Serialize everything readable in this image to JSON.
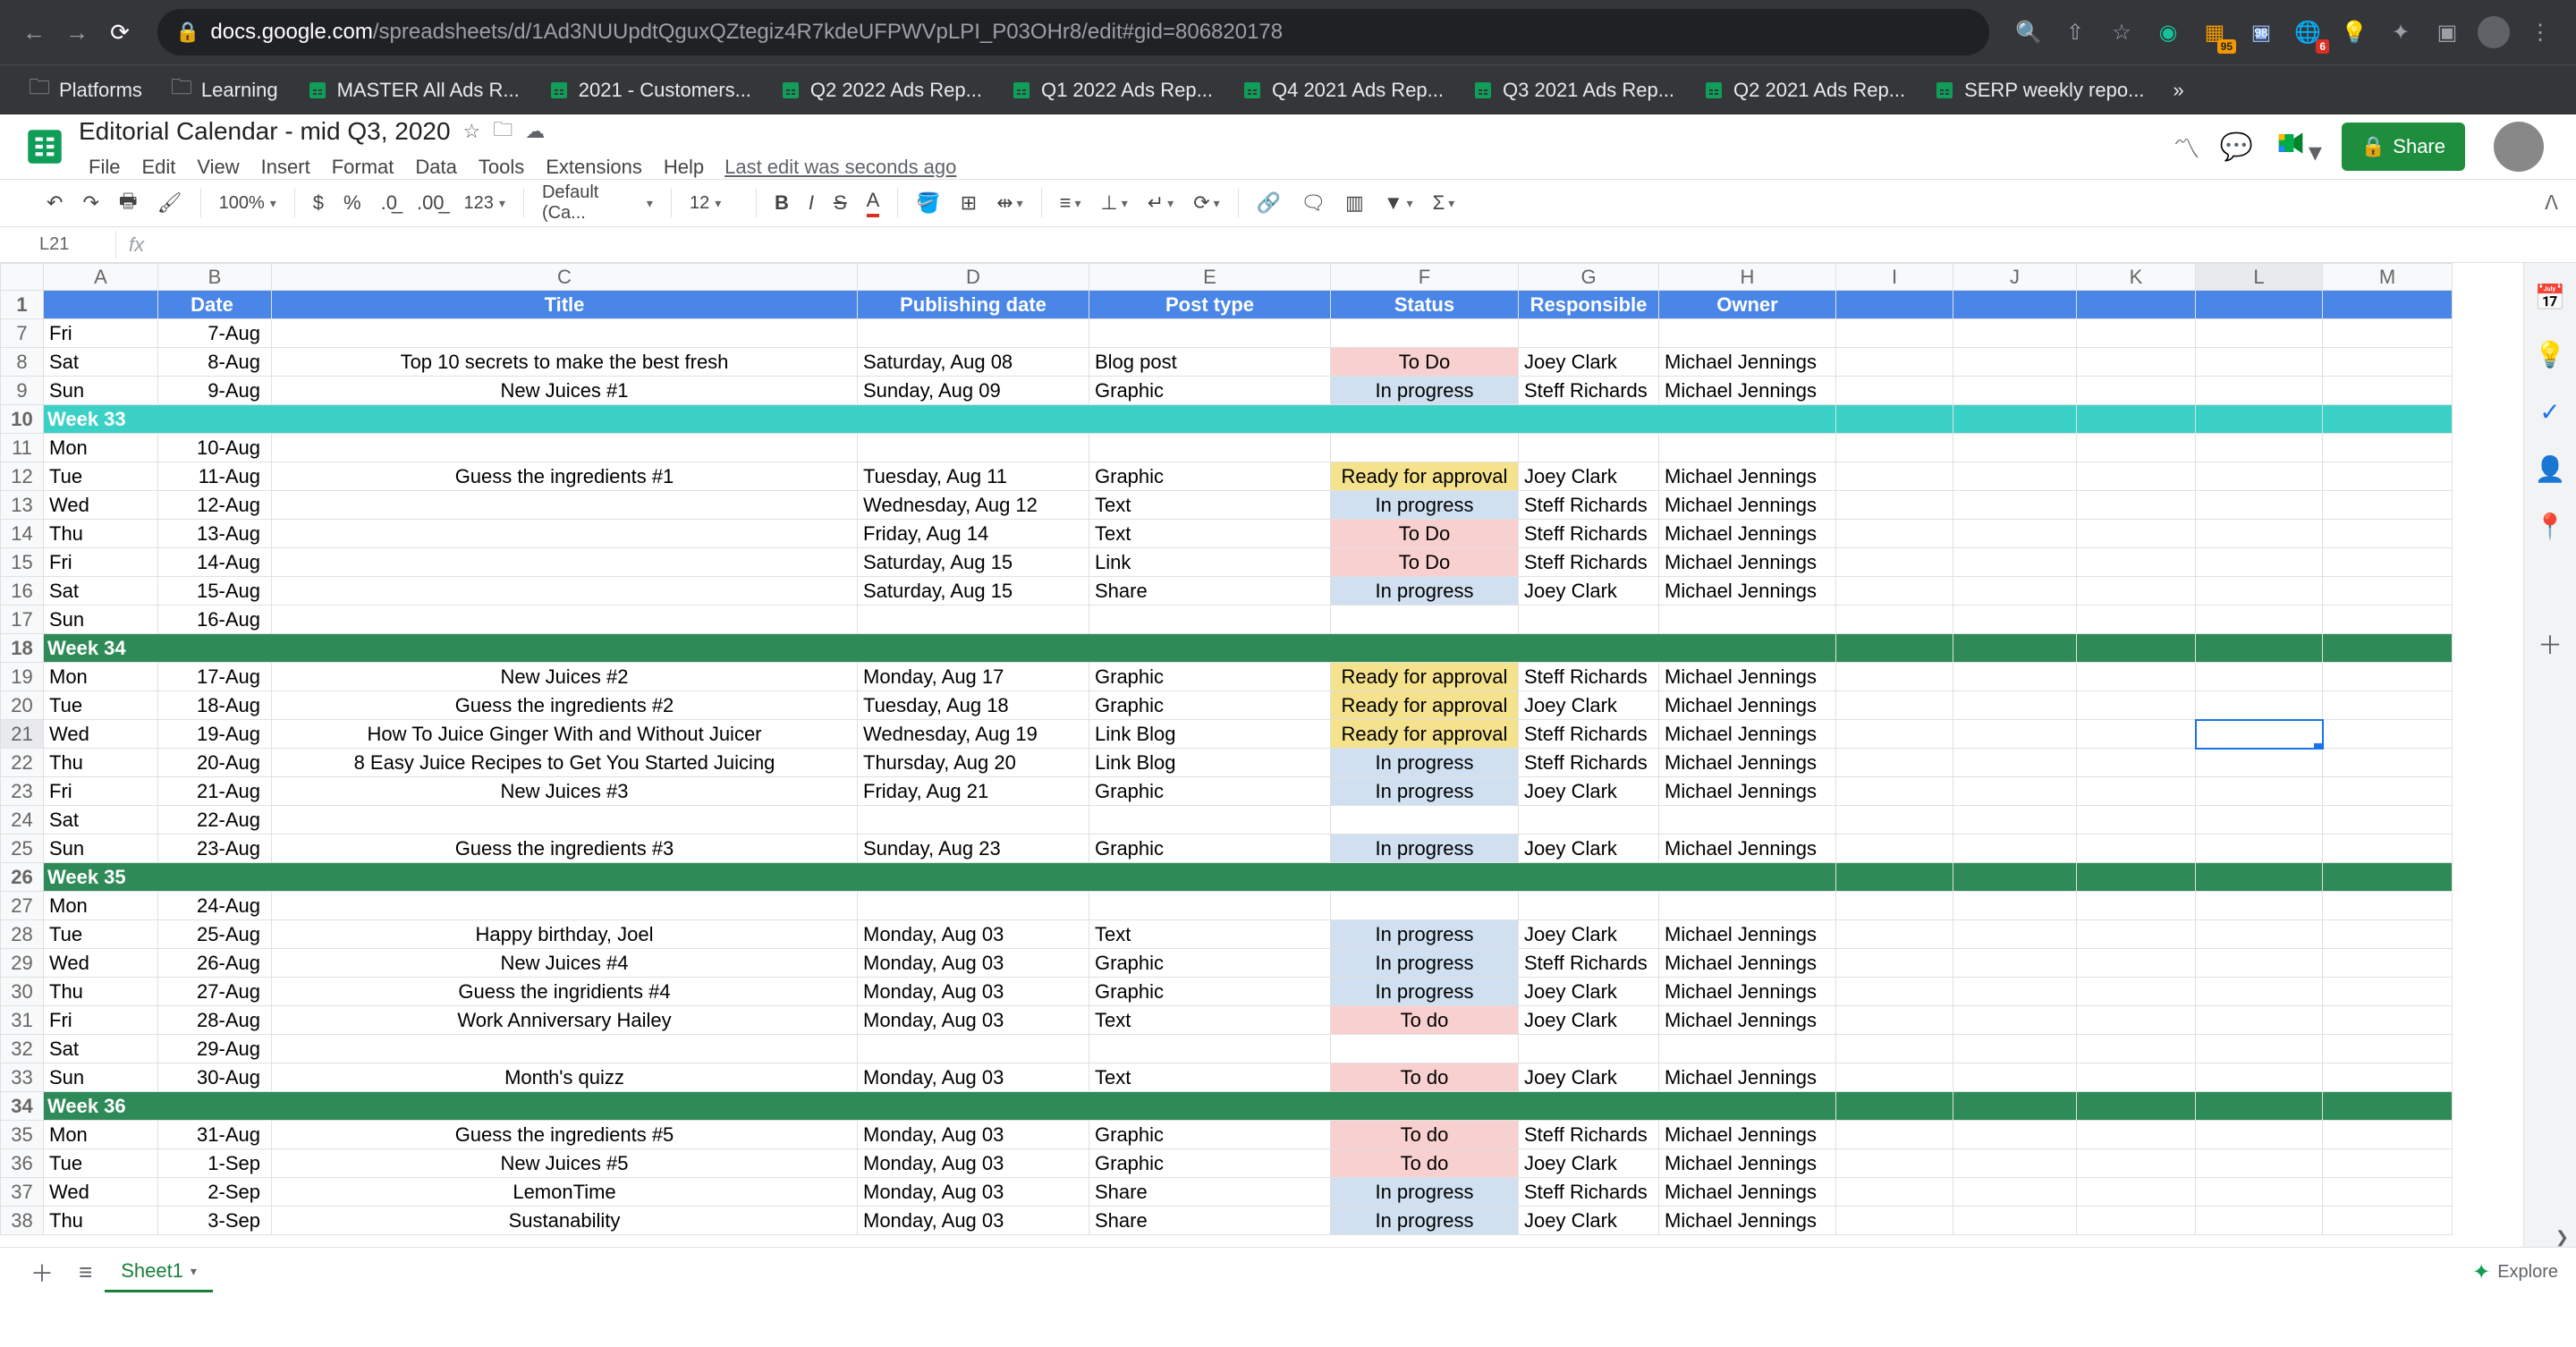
{
  "browser": {
    "url_domain": "docs.google.com",
    "url_path": "/spreadsheets/d/1Ad3NUUpdtQguxQZtegiz4R7kdeUFPWVpLPI_P03OHr8/edit#gid=806820178",
    "ext_badge_95": "95",
    "ext_badge_98": "98",
    "ext_badge_6": "6",
    "overflow": "»",
    "bookmarks": [
      {
        "type": "folder",
        "label": "Platforms"
      },
      {
        "type": "folder",
        "label": "Learning"
      },
      {
        "type": "sheet",
        "label": "MASTER All Ads R..."
      },
      {
        "type": "sheet",
        "label": "2021 - Customers..."
      },
      {
        "type": "sheet",
        "label": "Q2 2022 Ads Rep..."
      },
      {
        "type": "sheet",
        "label": "Q1 2022 Ads Rep..."
      },
      {
        "type": "sheet",
        "label": "Q4 2021 Ads Rep..."
      },
      {
        "type": "sheet",
        "label": "Q3 2021 Ads Rep..."
      },
      {
        "type": "sheet",
        "label": "Q2 2021 Ads Rep..."
      },
      {
        "type": "sheet",
        "label": "SERP weekly repo..."
      }
    ]
  },
  "doc": {
    "title": "Editorial Calendar - mid Q3, 2020",
    "menus": [
      "File",
      "Edit",
      "View",
      "Insert",
      "Format",
      "Data",
      "Tools",
      "Extensions",
      "Help"
    ],
    "last_edit": "Last edit was seconds ago",
    "share": "Share"
  },
  "toolbar": {
    "zoom": "100%",
    "font": "Default (Ca...",
    "size": "12",
    "more": "123"
  },
  "namebox": {
    "cell": "L21",
    "fx": "fx"
  },
  "sheet": {
    "tab": "Sheet1",
    "columns": [
      "A",
      "B",
      "C",
      "D",
      "E",
      "F",
      "G",
      "H",
      "I",
      "J",
      "K",
      "L",
      "M"
    ],
    "header": {
      "A": "",
      "B": "Date",
      "C": "Title",
      "D": "Publishing date",
      "E": "Post type",
      "F": "Status",
      "G": "Responsible",
      "H": "Owner"
    },
    "rows": [
      {
        "n": 7,
        "A": "Fri",
        "B": "7-Aug"
      },
      {
        "n": 8,
        "A": "Sat",
        "B": "8-Aug",
        "C": "Top 10 secrets to make the best fresh",
        "D": "Saturday, Aug 08",
        "E": "Blog post",
        "F": "To Do",
        "Fc": "st-todo",
        "G": "Joey Clark",
        "H": "Michael Jennings"
      },
      {
        "n": 9,
        "A": "Sun",
        "B": "9-Aug",
        "C": "New Juices #1",
        "D": "Sunday, Aug 09",
        "E": "Graphic",
        "F": "In progress",
        "Fc": "st-prog",
        "G": "Steff Richards",
        "H": "Michael Jennings"
      },
      {
        "n": 10,
        "week": "wk33",
        "A": "Week 33"
      },
      {
        "n": 11,
        "A": "Mon",
        "B": "10-Aug"
      },
      {
        "n": 12,
        "A": "Tue",
        "B": "11-Aug",
        "C": "Guess the ingredients #1",
        "D": "Tuesday, Aug 11",
        "E": "Graphic",
        "F": "Ready for approval",
        "Fc": "st-appr",
        "G": "Joey Clark",
        "H": "Michael Jennings"
      },
      {
        "n": 13,
        "A": "Wed",
        "B": "12-Aug",
        "D": "Wednesday, Aug 12",
        "E": "Text",
        "F": "In progress",
        "Fc": "st-prog",
        "G": "Steff Richards",
        "H": "Michael Jennings"
      },
      {
        "n": 14,
        "A": "Thu",
        "B": "13-Aug",
        "D": "Friday, Aug 14",
        "E": "Text",
        "F": "To Do",
        "Fc": "st-todo",
        "G": "Steff Richards",
        "H": "Michael Jennings"
      },
      {
        "n": 15,
        "A": "Fri",
        "B": "14-Aug",
        "D": "Saturday, Aug 15",
        "E": "Link",
        "F": "To Do",
        "Fc": "st-todo",
        "G": "Steff Richards",
        "H": "Michael Jennings"
      },
      {
        "n": 16,
        "A": "Sat",
        "B": "15-Aug",
        "D": "Saturday, Aug 15",
        "E": "Share",
        "F": "In progress",
        "Fc": "st-prog",
        "G": "Joey Clark",
        "H": "Michael Jennings"
      },
      {
        "n": 17,
        "A": "Sun",
        "B": "16-Aug"
      },
      {
        "n": 18,
        "week": "wk34",
        "A": "Week 34"
      },
      {
        "n": 19,
        "A": "Mon",
        "B": "17-Aug",
        "C": "New Juices #2",
        "D": "Monday, Aug 17",
        "E": "Graphic",
        "F": "Ready for approval",
        "Fc": "st-appr",
        "G": "Steff Richards",
        "H": "Michael Jennings"
      },
      {
        "n": 20,
        "A": "Tue",
        "B": "18-Aug",
        "C": "Guess the ingredients #2",
        "D": "Tuesday, Aug 18",
        "E": "Graphic",
        "F": "Ready for approval",
        "Fc": "st-appr",
        "G": "Joey Clark",
        "H": "Michael Jennings"
      },
      {
        "n": 21,
        "A": "Wed",
        "B": "19-Aug",
        "C": "How To Juice Ginger With and Without Juicer",
        "D": "Wednesday, Aug 19",
        "E": "Link Blog",
        "F": "Ready for approval",
        "Fc": "st-appr",
        "G": "Steff Richards",
        "H": "Michael Jennings"
      },
      {
        "n": 22,
        "A": "Thu",
        "B": "20-Aug",
        "C": "8 Easy Juice Recipes to Get You Started Juicing",
        "D": "Thursday, Aug 20",
        "E": "Link Blog",
        "F": "In progress",
        "Fc": "st-prog",
        "G": "Steff Richards",
        "H": "Michael Jennings"
      },
      {
        "n": 23,
        "A": "Fri",
        "B": "21-Aug",
        "C": "New Juices #3",
        "D": "Friday, Aug 21",
        "E": "Graphic",
        "F": "In progress",
        "Fc": "st-prog",
        "G": "Joey Clark",
        "H": "Michael Jennings"
      },
      {
        "n": 24,
        "A": "Sat",
        "B": "22-Aug"
      },
      {
        "n": 25,
        "A": "Sun",
        "B": "23-Aug",
        "C": "Guess the ingredients #3",
        "D": "Sunday, Aug 23",
        "E": "Graphic",
        "F": "In progress",
        "Fc": "st-prog",
        "G": "Joey Clark",
        "H": "Michael Jennings"
      },
      {
        "n": 26,
        "week": "wk34",
        "A": "Week 35"
      },
      {
        "n": 27,
        "A": "Mon",
        "B": "24-Aug"
      },
      {
        "n": 28,
        "A": "Tue",
        "B": "25-Aug",
        "C": "Happy birthday, Joel",
        "D": "Monday, Aug 03",
        "E": "Text",
        "F": "In progress",
        "Fc": "st-prog",
        "G": "Joey Clark",
        "H": "Michael Jennings"
      },
      {
        "n": 29,
        "A": "Wed",
        "B": "26-Aug",
        "C": "New Juices #4",
        "D": "Monday, Aug 03",
        "E": "Graphic",
        "F": "In progress",
        "Fc": "st-prog",
        "G": "Steff Richards",
        "H": "Michael Jennings"
      },
      {
        "n": 30,
        "A": "Thu",
        "B": "27-Aug",
        "C": "Guess the ingridients #4",
        "D": "Monday, Aug 03",
        "E": "Graphic",
        "F": "In progress",
        "Fc": "st-prog",
        "G": "Joey Clark",
        "H": "Michael Jennings"
      },
      {
        "n": 31,
        "A": "Fri",
        "B": "28-Aug",
        "C": "Work Anniversary Hailey",
        "D": "Monday, Aug 03",
        "E": "Text",
        "F": "To do",
        "Fc": "st-todo",
        "G": "Joey Clark",
        "H": "Michael Jennings"
      },
      {
        "n": 32,
        "A": "Sat",
        "B": "29-Aug"
      },
      {
        "n": 33,
        "A": "Sun",
        "B": "30-Aug",
        "C": "Month's quizz",
        "D": "Monday, Aug 03",
        "E": "Text",
        "F": "To do",
        "Fc": "st-todo",
        "G": "Joey Clark",
        "H": "Michael Jennings"
      },
      {
        "n": 34,
        "week": "wk34",
        "A": "Week 36"
      },
      {
        "n": 35,
        "A": "Mon",
        "B": "31-Aug",
        "C": "Guess the ingredients #5",
        "D": "Monday, Aug 03",
        "E": "Graphic",
        "F": "To do",
        "Fc": "st-todo",
        "G": "Steff Richards",
        "H": "Michael Jennings"
      },
      {
        "n": 36,
        "A": "Tue",
        "B": "1-Sep",
        "C": "New Juices #5",
        "D": "Monday, Aug 03",
        "E": "Graphic",
        "F": "To do",
        "Fc": "st-todo",
        "G": "Joey Clark",
        "H": "Michael Jennings"
      },
      {
        "n": 37,
        "A": "Wed",
        "B": "2-Sep",
        "C": "LemonTime",
        "D": "Monday, Aug 03",
        "E": "Share",
        "F": "In progress",
        "Fc": "st-prog",
        "G": "Steff Richards",
        "H": "Michael Jennings"
      },
      {
        "n": 38,
        "A": "Thu",
        "B": "3-Sep",
        "C": "Sustanability",
        "D": "Monday, Aug 03",
        "E": "Share",
        "F": "In progress",
        "Fc": "st-prog",
        "G": "Joey Clark",
        "H": "Michael Jennings"
      }
    ],
    "selected": "L21"
  },
  "explore": "Explore"
}
